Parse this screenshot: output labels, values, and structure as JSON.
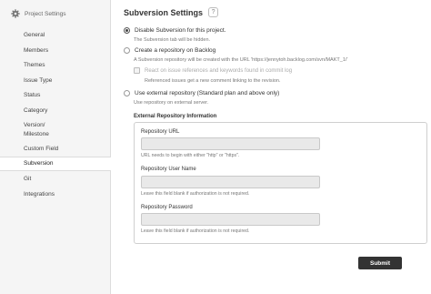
{
  "sidebar": {
    "header": "Project Settings",
    "items": [
      {
        "label": "General"
      },
      {
        "label": "Members"
      },
      {
        "label": "Themes"
      },
      {
        "label": "Issue Type"
      },
      {
        "label": "Status"
      },
      {
        "label": "Category"
      },
      {
        "label": "Version/\nMilestone"
      },
      {
        "label": "Custom Field"
      },
      {
        "label": "Subversion"
      },
      {
        "label": "Git"
      },
      {
        "label": "Integrations"
      }
    ],
    "active": "Subversion"
  },
  "main": {
    "title": "Subversion Settings",
    "help_glyph": "?",
    "options": [
      {
        "label": "Disable Subversion for this project.",
        "desc": "The Subversion tab will be hidden.",
        "selected": true
      },
      {
        "label": "Create a repository on Backlog",
        "desc": "A Subversion repository will be created with the URL 'https://jennytoh.backlog.com/svn/MAKT_1/'",
        "selected": false
      },
      {
        "label": "Use external repository (Standard plan and above only)",
        "desc": "Use repository on external server.",
        "selected": false
      }
    ],
    "checkbox": {
      "label": "React on issue references and keywords found in commit log",
      "desc": "Referenced issues get a new comment linking to the revision."
    },
    "external": {
      "section_title": "External Repository Information",
      "url_label": "Repository URL",
      "url_hint": "URL needs to begin with either \"http\" or \"https\".",
      "url_value": "",
      "user_label": "Repository User Name",
      "user_hint": "Leave this field blank if authorization is not required.",
      "user_value": "",
      "password_label": "Repository Password",
      "password_hint": "Leave this field blank if authorization is not required.",
      "password_value": ""
    },
    "submit_label": "Submit"
  },
  "colors": {
    "submit_bg": "#333333",
    "sidebar_bg": "#f5f5f5",
    "input_bg": "#e9e9e9"
  }
}
